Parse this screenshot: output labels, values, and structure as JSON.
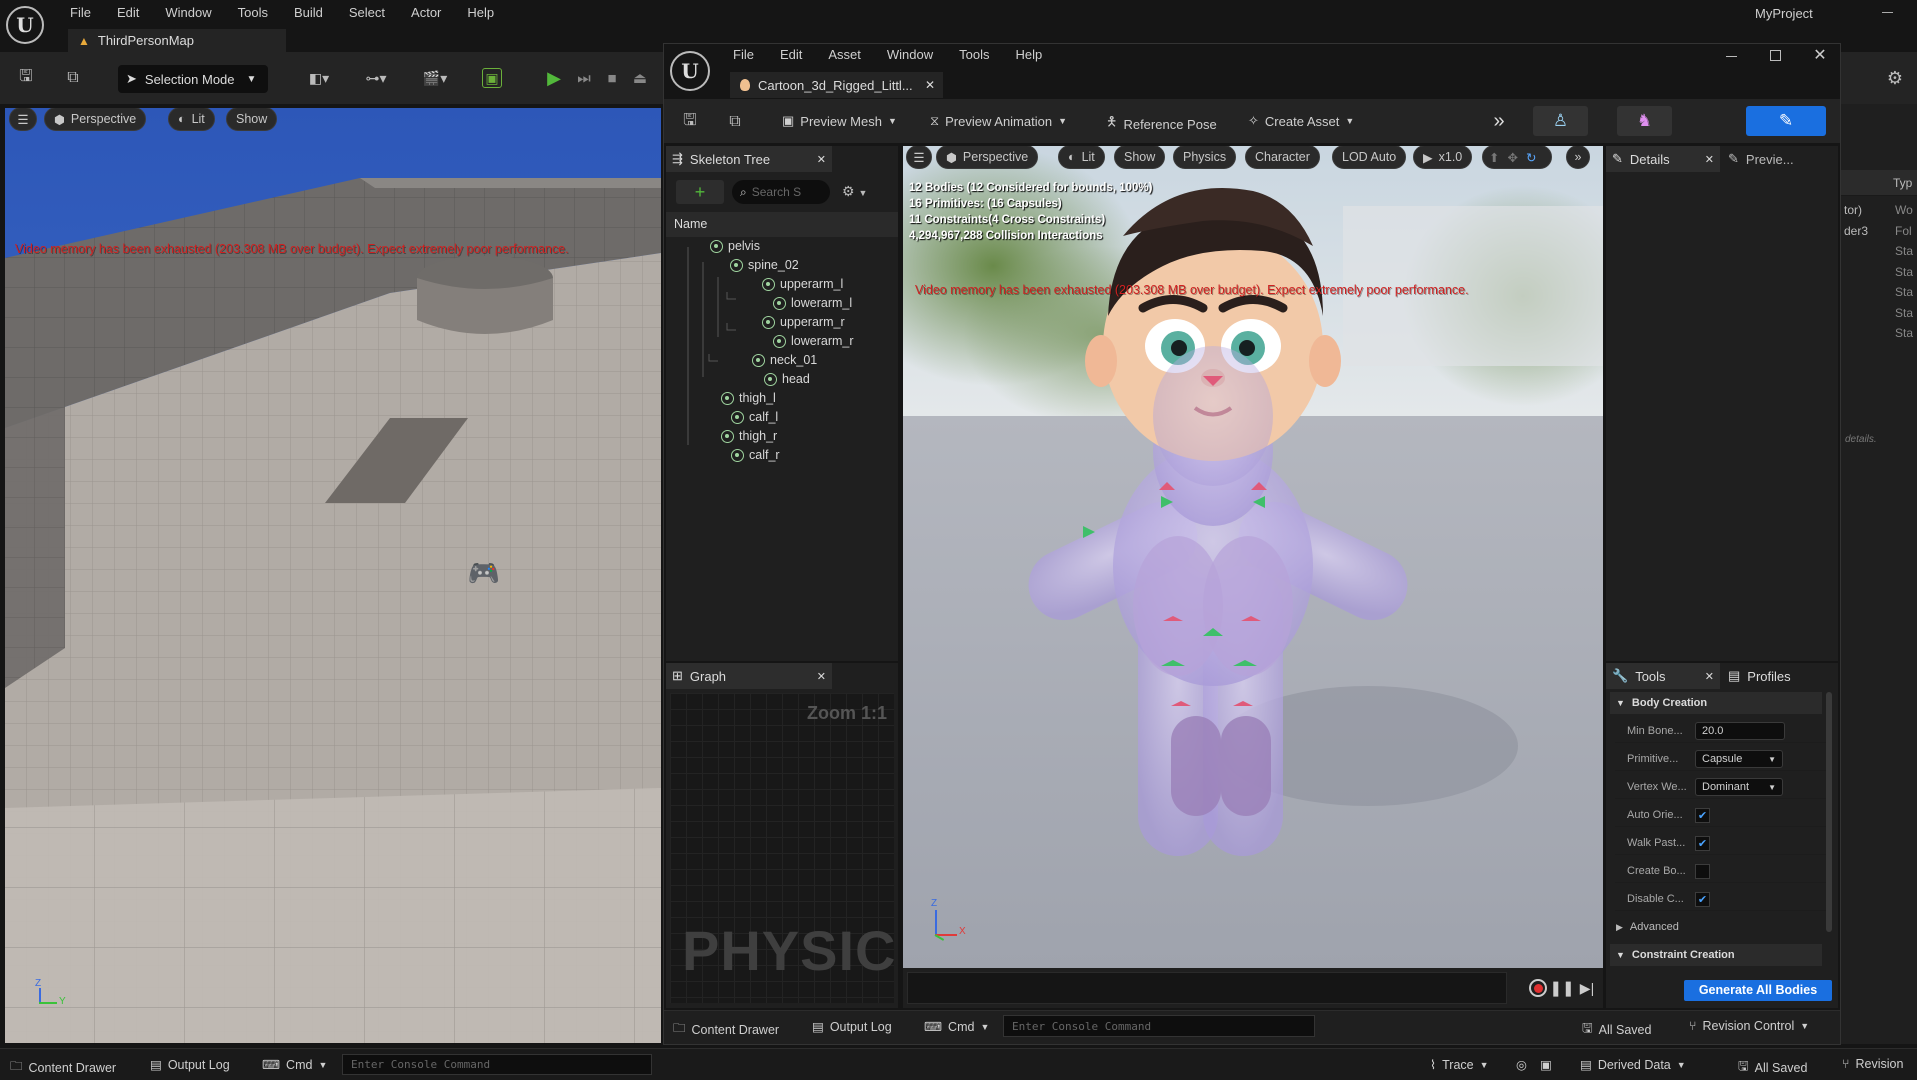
{
  "main": {
    "menu": [
      "File",
      "Edit",
      "Window",
      "Tools",
      "Build",
      "Select",
      "Actor",
      "Help"
    ],
    "project": "MyProject",
    "map_tab": "ThirdPersonMap",
    "selection_mode": "Selection Mode",
    "viewport": {
      "perspective": "Perspective",
      "lit": "Lit",
      "show": "Show"
    },
    "warning": "Video memory has been exhausted (203.308 MB over budget). Expect extremely poor performance.",
    "status": {
      "content_drawer": "Content Drawer",
      "output_log": "Output Log",
      "cmd": "Cmd",
      "console_placeholder": "Enter Console Command",
      "trace": "Trace",
      "derived_data": "Derived Data",
      "all_saved": "All Saved",
      "revision": "Revision"
    },
    "right_panel": {
      "col_header": "Typ",
      "types": [
        "Wo",
        "Fol",
        "Sta",
        "Sta",
        "Sta",
        "Sta",
        "Sta"
      ],
      "names": [
        "tor)",
        "",
        "",
        "",
        "",
        "",
        "der3"
      ],
      "hint": "details."
    }
  },
  "editor": {
    "menu": [
      "File",
      "Edit",
      "Asset",
      "Window",
      "Tools",
      "Help"
    ],
    "asset_tab": "Cartoon_3d_Rigged_Littl...",
    "toolbar": {
      "preview_mesh": "Preview Mesh",
      "preview_animation": "Preview Animation",
      "reference_pose": "Reference Pose",
      "create_asset": "Create Asset"
    },
    "skeleton_tree": {
      "title": "Skeleton Tree",
      "search_placeholder": "Search S",
      "column": "Name",
      "bones": [
        "pelvis",
        "spine_02",
        "upperarm_l",
        "lowerarm_l",
        "upperarm_r",
        "lowerarm_r",
        "neck_01",
        "head",
        "thigh_l",
        "calf_l",
        "thigh_r",
        "calf_r"
      ]
    },
    "graph": {
      "title": "Graph",
      "zoom": "Zoom 1:1",
      "watermark": "PHYSIC"
    },
    "viewport": {
      "perspective": "Perspective",
      "lit": "Lit",
      "show": "Show",
      "physics": "Physics",
      "character": "Character",
      "lod": "LOD Auto",
      "speed": "x1.0",
      "stats": [
        "12 Bodies (12 Considered for bounds, 100%)",
        "16 Primitives: (16 Capsules)",
        "11 Constraints(4 Cross Constraints)",
        "4,294,967,288 Collision Interactions"
      ],
      "warning": "Video memory has been exhausted (203.308 MB over budget). Expect extremely poor performance.",
      "axis_z": "Z",
      "axis_x": "X"
    },
    "details": {
      "title": "Details",
      "preview_tab": "Previe..."
    },
    "tools": {
      "tab": "Tools",
      "profiles_tab": "Profiles",
      "body_creation": "Body Creation",
      "min_bone_label": "Min Bone...",
      "min_bone_value": "20.0",
      "primitive_label": "Primitive...",
      "primitive_value": "Capsule",
      "vertex_label": "Vertex We...",
      "vertex_value": "Dominant",
      "auto_orient_label": "Auto Orie...",
      "auto_orient_checked": true,
      "walk_past_label": "Walk Past...",
      "walk_past_checked": true,
      "create_bo_label": "Create Bo...",
      "create_bo_checked": false,
      "disable_c_label": "Disable C...",
      "disable_c_checked": true,
      "advanced": "Advanced",
      "constraint_creation": "Constraint Creation",
      "generate_button": "Generate All Bodies"
    },
    "status": {
      "content_drawer": "Content Drawer",
      "output_log": "Output Log",
      "cmd": "Cmd",
      "console_placeholder": "Enter Console Command",
      "all_saved": "All Saved",
      "revision_control": "Revision Control"
    }
  },
  "colors": {
    "accent": "#1a6fe0",
    "play": "#52b83b",
    "warning": "#d02020",
    "bone": "#9fd49f"
  }
}
